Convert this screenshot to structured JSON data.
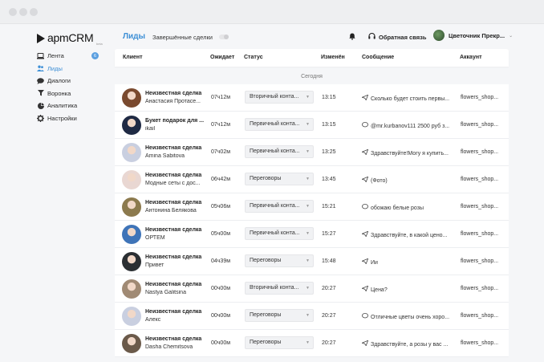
{
  "app": {
    "logo": "apmCRM",
    "logo_sub": "beta"
  },
  "sidebar": {
    "items": [
      {
        "label": "Лента",
        "icon": "laptop-icon",
        "badge": "6",
        "active": false
      },
      {
        "label": "Лиды",
        "icon": "users-icon",
        "active": true
      },
      {
        "label": "Диалоги",
        "icon": "chat-icon",
        "active": false
      },
      {
        "label": "Воронка",
        "icon": "funnel-icon",
        "active": false
      },
      {
        "label": "Аналитика",
        "icon": "pie-chart-icon",
        "active": false
      },
      {
        "label": "Настройки",
        "icon": "gear-icon",
        "active": false
      }
    ]
  },
  "header": {
    "title": "Лиды",
    "tab": "Завершённые сделки",
    "support": "Обратная связь",
    "account": "Цветочник Прекр..."
  },
  "table": {
    "columns": [
      "Клиент",
      "Ожидает",
      "Статус",
      "Изменён",
      "Сообщение",
      "Аккаунт"
    ],
    "section": "Сегодня",
    "rows": [
      {
        "name": "Неизвестная сделка",
        "sub": "Анастасия Протасе...",
        "wait": "07ч12м",
        "status": "Вторичный конта...",
        "changed": "13:15",
        "msg_icon": "send",
        "message": "Сколько будет стоить первы...",
        "account": "flowers_shop...",
        "avatar": "#7a4a2f"
      },
      {
        "name": "Букет подарок для ...",
        "sub": "ikail",
        "wait": "07ч12м",
        "status": "Первичный конта...",
        "changed": "13:15",
        "msg_icon": "chat",
        "message": "@mr.kurbanov111 2500 руб з...",
        "account": "flowers_shop...",
        "avatar": "#1f2a44"
      },
      {
        "name": "Неизвестная сделка",
        "sub": "Amina Sabitova",
        "wait": "07ч02м",
        "status": "Первичный конта...",
        "changed": "13:25",
        "msg_icon": "send",
        "message": "Здравствуйте!Могу я купить...",
        "account": "flowers_shop...",
        "avatar": "#c9cfe0"
      },
      {
        "name": "Неизвестная сделка",
        "sub": "Модные сеты с дос...",
        "wait": "06ч42м",
        "status": "Переговоры",
        "changed": "13:45",
        "msg_icon": "send",
        "message": "(Фото)",
        "account": "flowers_shop...",
        "avatar": "#e9d7d2"
      },
      {
        "name": "Неизвестная сделка",
        "sub": "Антонина Белякова",
        "wait": "05ч06м",
        "status": "Первичный конта...",
        "changed": "15:21",
        "msg_icon": "chat",
        "message": "обожаю белые розы",
        "account": "flowers_shop...",
        "avatar": "#8c7a4e"
      },
      {
        "name": "Неизвестная сделка",
        "sub": "ОРТЕМ",
        "wait": "05ч00м",
        "status": "Первичный конта...",
        "changed": "15:27",
        "msg_icon": "send",
        "message": "Здравствуйте, в какой цено...",
        "account": "flowers_shop...",
        "avatar": "#3f74b8"
      },
      {
        "name": "Неизвестная сделка",
        "sub": "Привет",
        "wait": "04ч39м",
        "status": "Переговоры",
        "changed": "15:48",
        "msg_icon": "send",
        "message": "Ии",
        "account": "flowers_shop...",
        "avatar": "#2b2f33"
      },
      {
        "name": "Неизвестная сделка",
        "sub": "Nastya Galitsina",
        "wait": "00ч00м",
        "status": "Вторичный конта...",
        "changed": "20:27",
        "msg_icon": "send",
        "message": "Цена?",
        "account": "flowers_shop...",
        "avatar": "#a08a74"
      },
      {
        "name": "Неизвестная сделка",
        "sub": "Алекс",
        "wait": "00ч00м",
        "status": "Переговоры",
        "changed": "20:27",
        "msg_icon": "chat",
        "message": "Отличные цветы очень хоро...",
        "account": "flowers_shop...",
        "avatar": "#c9cfe0"
      },
      {
        "name": "Неизвестная сделка",
        "sub": "Dasha Chemitsova",
        "wait": "00ч00м",
        "status": "Переговоры",
        "changed": "20:27",
        "msg_icon": "send",
        "message": "Здравствуйте, а розы у вас ...",
        "account": "flowers_shop...",
        "avatar": "#6b5a4a"
      }
    ]
  }
}
